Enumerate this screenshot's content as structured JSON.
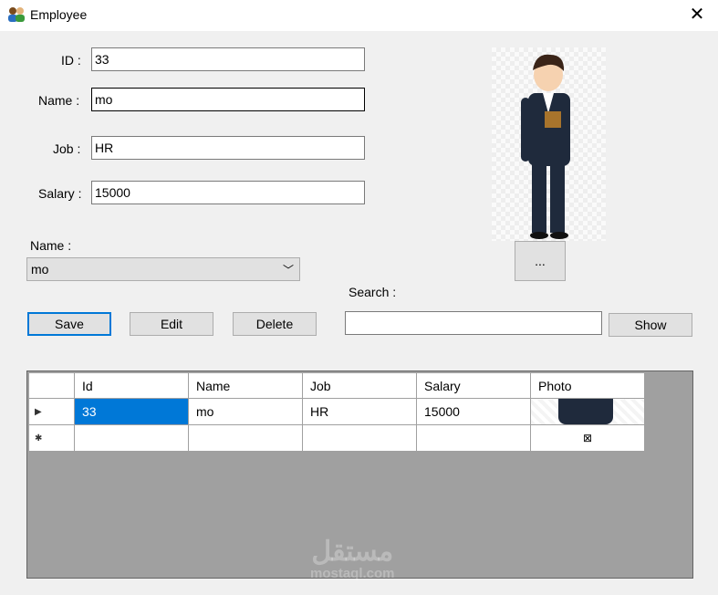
{
  "window": {
    "title": "Employee",
    "close_icon": "close-icon"
  },
  "form": {
    "id_label": "ID :",
    "id_value": "33",
    "name_label": "Name :",
    "name_value": "mo",
    "job_label": "Job :",
    "job_value": "HR",
    "salary_label": "Salary :",
    "salary_value": "15000",
    "combo_label": "Name :",
    "combo_value": "mo",
    "browse_label": "...",
    "search_label": "Search :",
    "search_value": ""
  },
  "buttons": {
    "save": "Save",
    "edit": "Edit",
    "delete": "Delete",
    "show": "Show"
  },
  "grid": {
    "columns": [
      "Id",
      "Name",
      "Job",
      "Salary",
      "Photo"
    ],
    "rows": [
      {
        "id": "33",
        "name": "mo",
        "job": "HR",
        "salary": "15000"
      }
    ],
    "new_row_photo": "⊠"
  },
  "watermark": {
    "arabic": "مستقل",
    "latin": "mostaql.com"
  }
}
